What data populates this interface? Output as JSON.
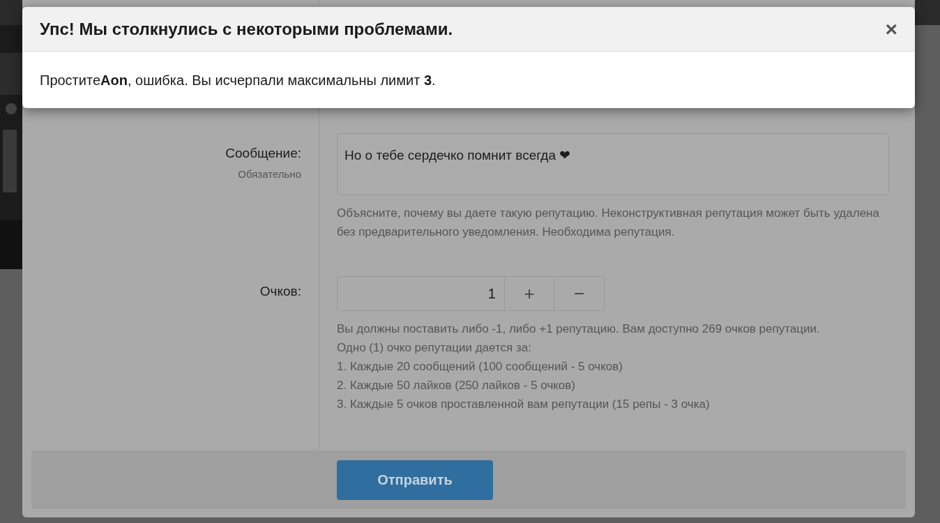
{
  "error_dialog": {
    "title": "Упс! Мы столкнулись с некоторыми проблемами.",
    "close": "×",
    "message": "Простите**Aon**, ошибка. Вы исчерпали максимальны лимит **3**."
  },
  "form": {
    "message_field": {
      "label": "Сообщение:",
      "hint": "Обязательно",
      "value": "Но о тебе сердечко помнит всегда ❤",
      "help": "Объясните, почему вы даете такую репутацию. Неконструктивная репутация может быть удалена без предварительного уведомления. Необходима репутация."
    },
    "points": {
      "label": "Очков:",
      "value": "1",
      "increment": "+",
      "decrement": "−",
      "help": [
        "Вы должны поставить либо -1, либо +1 репутацию. Вам доступно 269 очков репутации.",
        "Одно (1) очко репутации дается за:",
        "1. Каждые 20 сообщений (100 сообщений - 5 очков)",
        "2. Каждые 50 лайков (250 лайков - 5 очков)",
        "3. Каждые 5 очков проставленной вам репутации (15 репы - 3 очка)"
      ]
    },
    "submit": "Отправить"
  }
}
